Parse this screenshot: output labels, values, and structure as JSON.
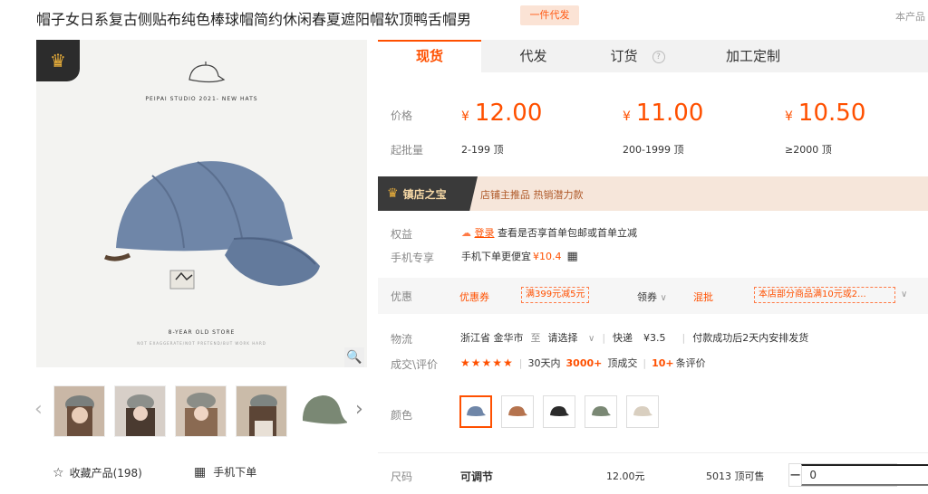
{
  "header": {
    "title": "帽子女日系复古侧贴布纯色棒球帽简约休闲春夏遮阳帽软顶鸭舌帽男",
    "tag": "一件代发",
    "right_note": "本产品"
  },
  "gallery": {
    "caption_top": "PEIPAI STUDIO 2021- NEW HATS",
    "caption_store": "8-YEAR OLD STORE",
    "caption_sub": "NOT EXAGGERATE/NOT PRETEND/BUT WORK HARD",
    "thumbnails": [
      "thumb-1",
      "thumb-2",
      "thumb-3",
      "thumb-4",
      "thumb-5"
    ],
    "favorite_label": "收藏产品(198)",
    "mobile_order_label": "手机下单"
  },
  "tabs": [
    {
      "label": "现货",
      "active": true
    },
    {
      "label": "代发",
      "active": false
    },
    {
      "label": "订货",
      "active": false
    },
    {
      "label": "加工定制",
      "active": false
    }
  ],
  "pricing": {
    "price_label": "价格",
    "moq_label": "起批量",
    "currency": "¥",
    "tiers": [
      {
        "price": "12.00",
        "range": "2-199 顶"
      },
      {
        "price": "11.00",
        "range": "200-1999 顶"
      },
      {
        "price": "10.50",
        "range": "≥2000 顶"
      }
    ]
  },
  "banner": {
    "title": "镇店之宝",
    "text": "店铺主推品   热销潜力款"
  },
  "benefits": {
    "rights_label": "权益",
    "login_link": "登录",
    "rights_text": "查看是否享首单包邮或首单立减",
    "mobile_label": "手机专享",
    "mobile_text": "手机下单更便宜",
    "mobile_price": "¥10.4"
  },
  "promo": {
    "label": "优惠",
    "coupon_title": "优惠券",
    "coupon_value": "满399元减5元",
    "claim_label": "领券",
    "mixed_label": "混批",
    "mixed_value": "本店部分商品满10元或2..."
  },
  "logistics": {
    "label": "物流",
    "origin": "浙江省 金华市",
    "to": "至",
    "destination": "请选择",
    "express": "快递",
    "fee": "¥3.5",
    "shipping_note": "付款成功后2天内安排发货"
  },
  "reviews": {
    "label": "成交\\评价",
    "stars": "★★★★★",
    "sold_prefix": "30天内",
    "sold_count": "3000+",
    "sold_suffix": "顶成交",
    "review_count": "10+",
    "review_suffix": "条评价"
  },
  "color": {
    "label": "颜色",
    "options": [
      "#6f86a8",
      "#b5734e",
      "#2b2b2b",
      "#7a8874",
      "#d9cfc0"
    ]
  },
  "size": {
    "label": "尺码",
    "value": "可调节",
    "price": "12.00元",
    "stock": "5013 顶可售",
    "quantity": "0"
  },
  "colors": {
    "accent": "#ff5000"
  }
}
